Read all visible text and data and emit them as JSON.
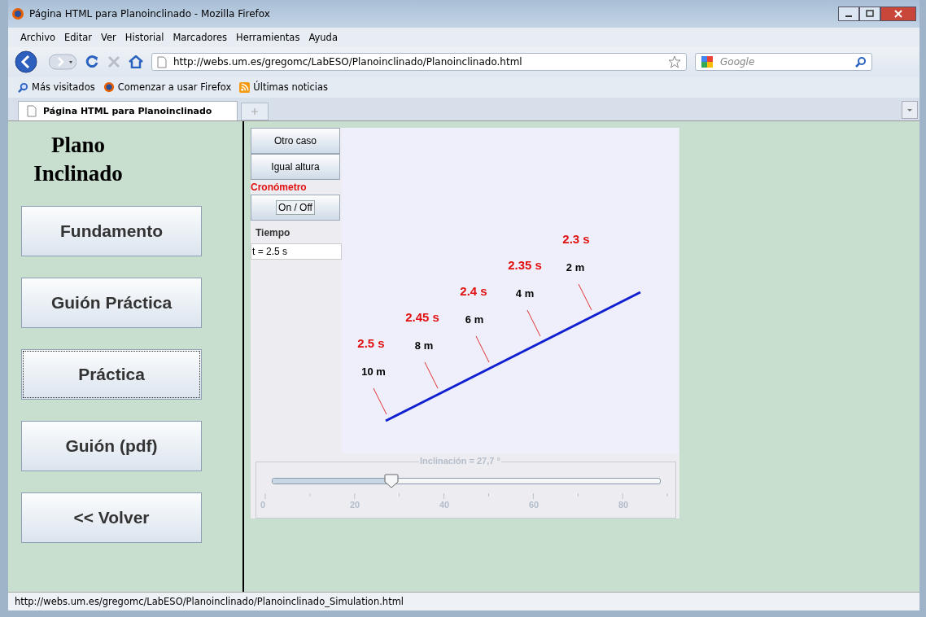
{
  "window": {
    "title": "Página HTML para Planoinclinado - Mozilla Firefox"
  },
  "menu": [
    "Archivo",
    "Editar",
    "Ver",
    "Historial",
    "Marcadores",
    "Herramientas",
    "Ayuda"
  ],
  "address": {
    "value": "http://webs.um.es/gregomc/LabESO/Planoinclinado/Planoinclinado.html"
  },
  "search": {
    "placeholder": "Google"
  },
  "bookmarks": [
    "Más visitados",
    "Comenzar a usar Firefox",
    "Últimas noticias"
  ],
  "tabs": [
    {
      "label": "Página HTML para Planoinclinado",
      "selected": true
    }
  ],
  "page": {
    "title": "Plano Inclinado",
    "nav_buttons": [
      {
        "label": "Fundamento",
        "selected": false
      },
      {
        "label": "Guión Práctica",
        "selected": false
      },
      {
        "label": "Práctica",
        "selected": true
      },
      {
        "label": "Guión (pdf)",
        "selected": false
      },
      {
        "label": "<< Volver",
        "selected": false
      }
    ]
  },
  "simulation": {
    "buttons": [
      "Otro caso",
      "Igual altura"
    ],
    "stopwatch_label": "Cronómetro",
    "toggle": "On / Off",
    "time_label": "Tiempo",
    "time_field": {
      "value": "t = 2.5 s"
    },
    "marks": [
      {
        "time": "2.5 s",
        "distance": "10 m"
      },
      {
        "time": "2.45 s",
        "distance": "8 m"
      },
      {
        "time": "2.4 s",
        "distance": "6 m"
      },
      {
        "time": "2.35 s",
        "distance": "4 m"
      },
      {
        "time": "2.3 s",
        "distance": "2 m"
      }
    ],
    "slider": {
      "title": "Inclinación = 27,7 °",
      "level": 0.308,
      "tick_labels": [
        "0",
        "20",
        "40",
        "60",
        "80"
      ]
    }
  },
  "status_bar": "http://webs.um.es/gregomc/LabESO/Planoinclinado/Planoinclinado_Simulation.html"
}
